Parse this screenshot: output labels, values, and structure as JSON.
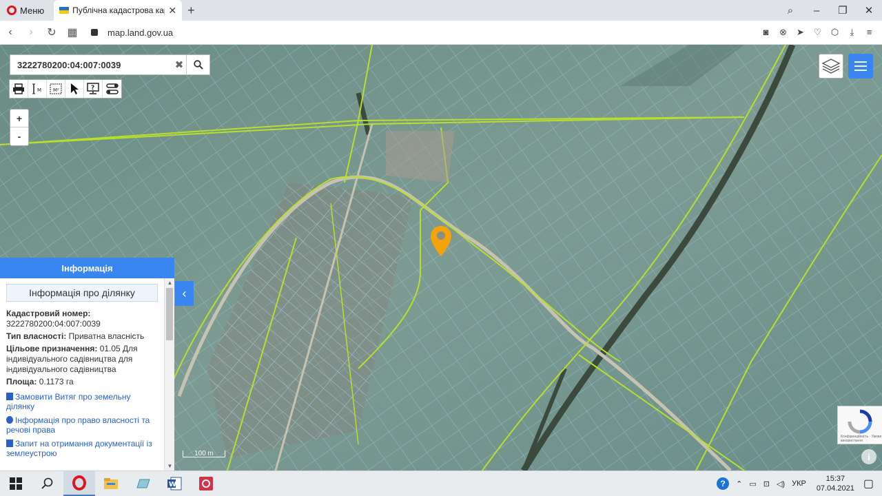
{
  "browser": {
    "menu_label": "Меню",
    "tab_title": "Публічна кадастрова карт",
    "url": "map.land.gov.ua"
  },
  "search": {
    "value": "3222780200:04:007:0039"
  },
  "zoom": {
    "in_label": "+",
    "out_label": "-"
  },
  "info_panel": {
    "header": "Інформація",
    "section_title": "Інформація про ділянку",
    "cadastral_label": "Кадастровий номер:",
    "cadastral_value": "3222780200:04:007:0039",
    "ownership_label": "Тип власності:",
    "ownership_value": "Приватна власність",
    "purpose_label": "Цільове призначення:",
    "purpose_value": "01.05 Для індивідуального садівництва для індивідуального садівництва",
    "area_label": "Площа:",
    "area_value": "0.1173 га",
    "links": [
      "Замовити Витяг про земельну ділянку",
      "Інформація про право власності та речові права",
      "Запит на отримання документації із землеустрою"
    ]
  },
  "map": {
    "scale_label": "100 m",
    "recaptcha_text": "Конфіденційність · Умови використання"
  },
  "taskbar": {
    "lang": "УКР",
    "time": "15:37",
    "date": "07.04.2021"
  },
  "colors": {
    "accent": "#3a86f0",
    "pin": "#f5a30a",
    "parcel_line": "#9fd9f2",
    "boundary_line": "#b8e02a"
  }
}
